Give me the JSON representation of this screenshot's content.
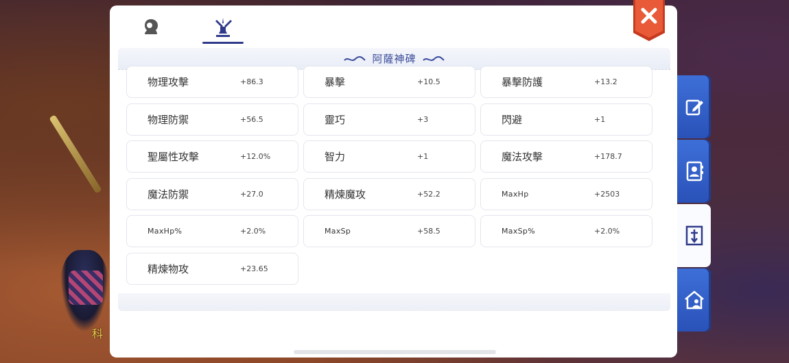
{
  "background": {
    "name_text": "科"
  },
  "tabs": [
    {
      "icon": "portrait-icon",
      "active": false
    },
    {
      "icon": "windmill-icon",
      "active": true
    }
  ],
  "section": {
    "title": "阿薩神碑"
  },
  "stats": [
    {
      "label": "物理攻擊",
      "value": "+86.3"
    },
    {
      "label": "暴擊",
      "value": "+10.5"
    },
    {
      "label": "暴擊防護",
      "value": "+13.2"
    },
    {
      "label": "物理防禦",
      "value": "+56.5"
    },
    {
      "label": "靈巧",
      "value": "+3"
    },
    {
      "label": "閃避",
      "value": "+1"
    },
    {
      "label": "聖屬性攻擊",
      "value": "+12.0%"
    },
    {
      "label": "智力",
      "value": "+1"
    },
    {
      "label": "魔法攻擊",
      "value": "+178.7"
    },
    {
      "label": "魔法防禦",
      "value": "+27.0"
    },
    {
      "label": "精煉魔攻",
      "value": "+52.2"
    },
    {
      "label": "MaxHp",
      "value": "+2503"
    },
    {
      "label": "MaxHp%",
      "value": "+2.0%"
    },
    {
      "label": "MaxSp",
      "value": "+58.5"
    },
    {
      "label": "MaxSp%",
      "value": "+2.0%"
    },
    {
      "label": "精煉物攻",
      "value": "+23.65"
    }
  ],
  "side_tabs": [
    {
      "icon": "edit-icon",
      "active": false
    },
    {
      "icon": "contact-book-icon",
      "active": false
    },
    {
      "icon": "monument-icon",
      "active": true
    },
    {
      "icon": "guild-house-icon",
      "active": false
    }
  ],
  "colors": {
    "accent": "#2f3a8a",
    "side_tab_blue": "#2f5fc8",
    "close_red": "#e0452a"
  }
}
